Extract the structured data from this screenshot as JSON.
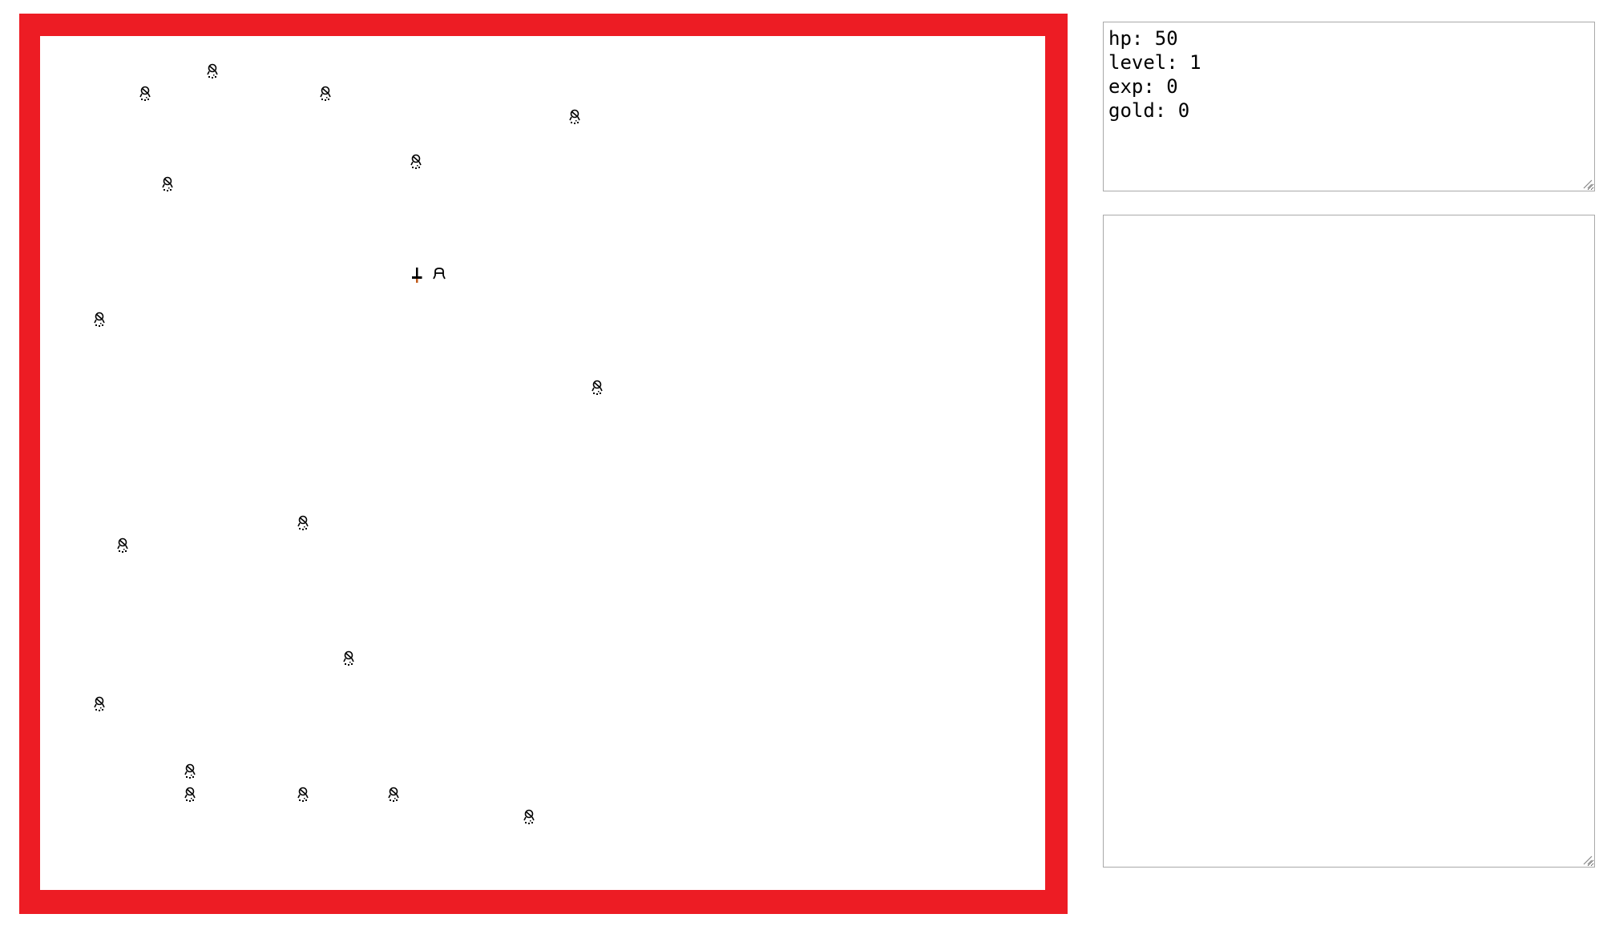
{
  "game": {
    "border_color": "#ed1c24",
    "background_color": "#ffffff",
    "player": {
      "icon": "sword-icon",
      "col": 16,
      "row": 10
    },
    "hero_companion": {
      "icon": "hero-icon",
      "col": 17,
      "row": 10
    },
    "monsters": [
      {
        "icon": "monster-icon",
        "col": 7,
        "row": 1
      },
      {
        "icon": "monster-icon",
        "col": 4,
        "row": 2
      },
      {
        "icon": "monster-icon",
        "col": 12,
        "row": 2
      },
      {
        "icon": "monster-icon",
        "col": 23,
        "row": 3
      },
      {
        "icon": "monster-icon",
        "col": 16,
        "row": 5
      },
      {
        "icon": "monster-icon",
        "col": 5,
        "row": 6
      },
      {
        "icon": "monster-icon",
        "col": 2,
        "row": 12
      },
      {
        "icon": "monster-icon",
        "col": 24,
        "row": 15
      },
      {
        "icon": "monster-icon",
        "col": 11,
        "row": 21
      },
      {
        "icon": "monster-icon",
        "col": 3,
        "row": 22
      },
      {
        "icon": "monster-icon",
        "col": 13,
        "row": 27
      },
      {
        "icon": "monster-icon",
        "col": 2,
        "row": 29
      },
      {
        "icon": "monster-icon",
        "col": 6,
        "row": 32
      },
      {
        "icon": "monster-icon",
        "col": 6,
        "row": 33
      },
      {
        "icon": "monster-icon",
        "col": 11,
        "row": 33
      },
      {
        "icon": "monster-icon",
        "col": 15,
        "row": 33
      },
      {
        "icon": "monster-icon",
        "col": 21,
        "row": 34
      }
    ]
  },
  "stats": {
    "hp": "hp: 50",
    "level": "level: 1",
    "exp": "exp: 0",
    "gold": "gold: 0"
  },
  "log": {
    "text": ""
  }
}
